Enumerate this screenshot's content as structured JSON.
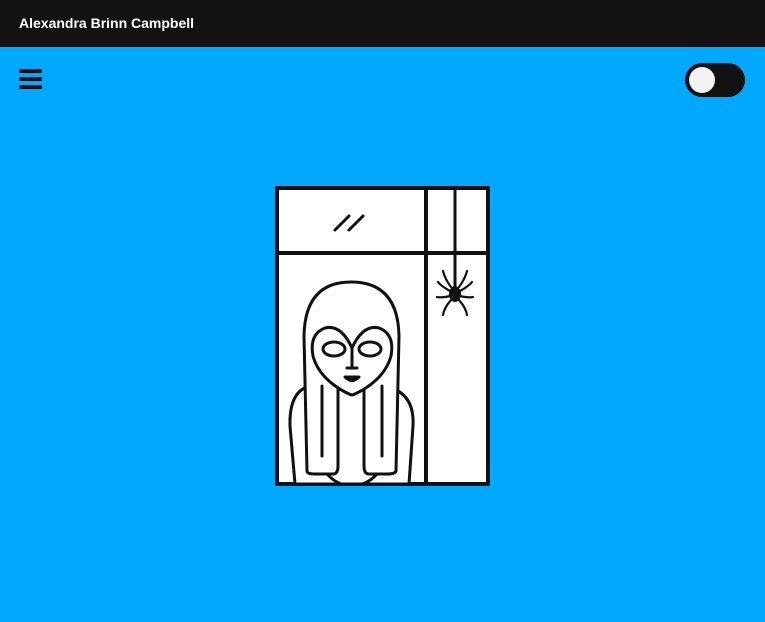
{
  "header": {
    "site_title": "Alexandra Brinn Campbell"
  },
  "colors": {
    "background": "#00a9ff",
    "topbar": "#121212",
    "ink": "#111111"
  },
  "icons": {
    "menu": "hamburger-menu-icon",
    "theme_toggle": "dark-mode-toggle"
  },
  "theme_toggle": {
    "state": "off"
  },
  "illustration": {
    "subject": "woman-in-window-with-spider"
  }
}
